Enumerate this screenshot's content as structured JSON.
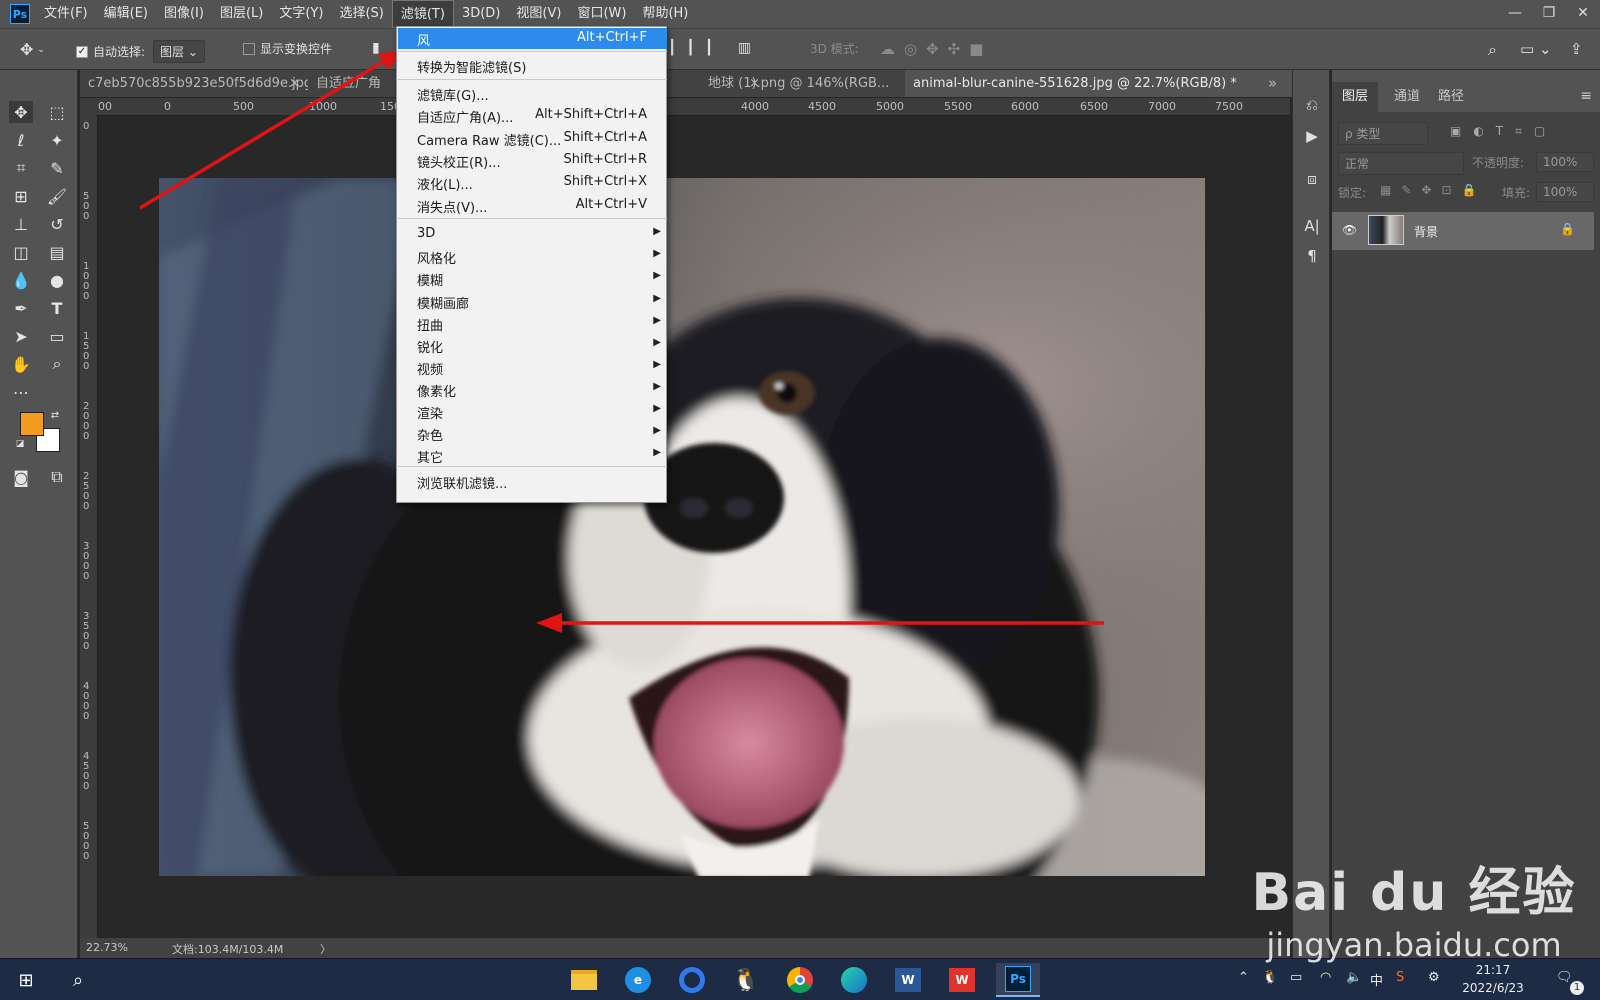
{
  "app": {
    "logo": "Ps"
  },
  "menubar": {
    "items": [
      "文件(F)",
      "编辑(E)",
      "图像(I)",
      "图层(L)",
      "文字(Y)",
      "选择(S)",
      "滤镜(T)",
      "3D(D)",
      "视图(V)",
      "窗口(W)",
      "帮助(H)"
    ],
    "active_index": 6
  },
  "window_controls": {
    "minimize": "—",
    "restore": "❐",
    "close": "✕"
  },
  "options": {
    "auto_select_label": "自动选择:",
    "auto_select_value": "图层",
    "transform_label": "显示变换控件",
    "mode3d_label": "3D 模式:"
  },
  "tabs": [
    {
      "label": "c7eb570c855b923e50f5d6d9e.jpg",
      "close": "×"
    },
    {
      "label": "自适应广角",
      "close": "×"
    },
    {
      "label": "地球 (1).png @ 146%(RGB...",
      "close": "×"
    },
    {
      "label": "animal-blur-canine-551628.jpg @ 22.7%(RGB/8) *",
      "close": "×"
    }
  ],
  "tabs_overflow": "»",
  "ruler": {
    "h_ticks": [
      "00",
      "0",
      "500",
      "1000",
      "1500",
      "4000",
      "4500",
      "5000",
      "5500",
      "6000",
      "6500",
      "7000",
      "7500"
    ],
    "v_ticks": [
      "0",
      "5 0 0",
      "1 0 0 0",
      "1 5 0 0",
      "2 0 0 0",
      "2 5 0 0",
      "3 0 0 0",
      "3 5 0 0",
      "4 0 0 0",
      "4 5 0 0",
      "5 0 0 0"
    ]
  },
  "status": {
    "zoom": "22.73%",
    "doc": "文档:103.4M/103.4M",
    "arrow": "〉"
  },
  "filter_menu": {
    "items": [
      {
        "label": "风",
        "shortcut": "Alt+Ctrl+F",
        "highlight": true
      },
      {
        "label": "转换为智能滤镜(S)",
        "shortcut": ""
      },
      {
        "label": "滤镜库(G)...",
        "shortcut": ""
      },
      {
        "label": "自适应广角(A)...",
        "shortcut": "Alt+Shift+Ctrl+A"
      },
      {
        "label": "Camera Raw 滤镜(C)...",
        "shortcut": "Shift+Ctrl+A"
      },
      {
        "label": "镜头校正(R)...",
        "shortcut": "Shift+Ctrl+R"
      },
      {
        "label": "液化(L)...",
        "shortcut": "Shift+Ctrl+X"
      },
      {
        "label": "消失点(V)...",
        "shortcut": "Alt+Ctrl+V"
      },
      {
        "label": "3D",
        "submenu": true
      },
      {
        "label": "风格化",
        "submenu": true
      },
      {
        "label": "模糊",
        "submenu": true
      },
      {
        "label": "模糊画廊",
        "submenu": true
      },
      {
        "label": "扭曲",
        "submenu": true
      },
      {
        "label": "锐化",
        "submenu": true
      },
      {
        "label": "视频",
        "submenu": true
      },
      {
        "label": "像素化",
        "submenu": true
      },
      {
        "label": "渲染",
        "submenu": true
      },
      {
        "label": "杂色",
        "submenu": true
      },
      {
        "label": "其它",
        "submenu": true
      },
      {
        "label": "浏览联机滤镜..."
      }
    ]
  },
  "layers_panel": {
    "tabs": [
      "图层",
      "通道",
      "路径"
    ],
    "kind_label": "ρ 类型",
    "blend_mode": "正常",
    "opacity_label": "不透明度:",
    "opacity_value": "100%",
    "lock_label": "锁定:",
    "fill_label": "填充:",
    "fill_value": "100%",
    "layer_name": "背景"
  },
  "colors": {
    "foreground": "#f39b1f",
    "background": "#ffffff",
    "accent": "#2d8ceb",
    "annotation": "#e01414"
  },
  "taskbar": {
    "time": "21:17",
    "date": "2022/6/23",
    "ime": "中",
    "badge": "1"
  },
  "watermark": {
    "brand": "Bai du 经验",
    "url": "jingyan.baidu.com"
  }
}
